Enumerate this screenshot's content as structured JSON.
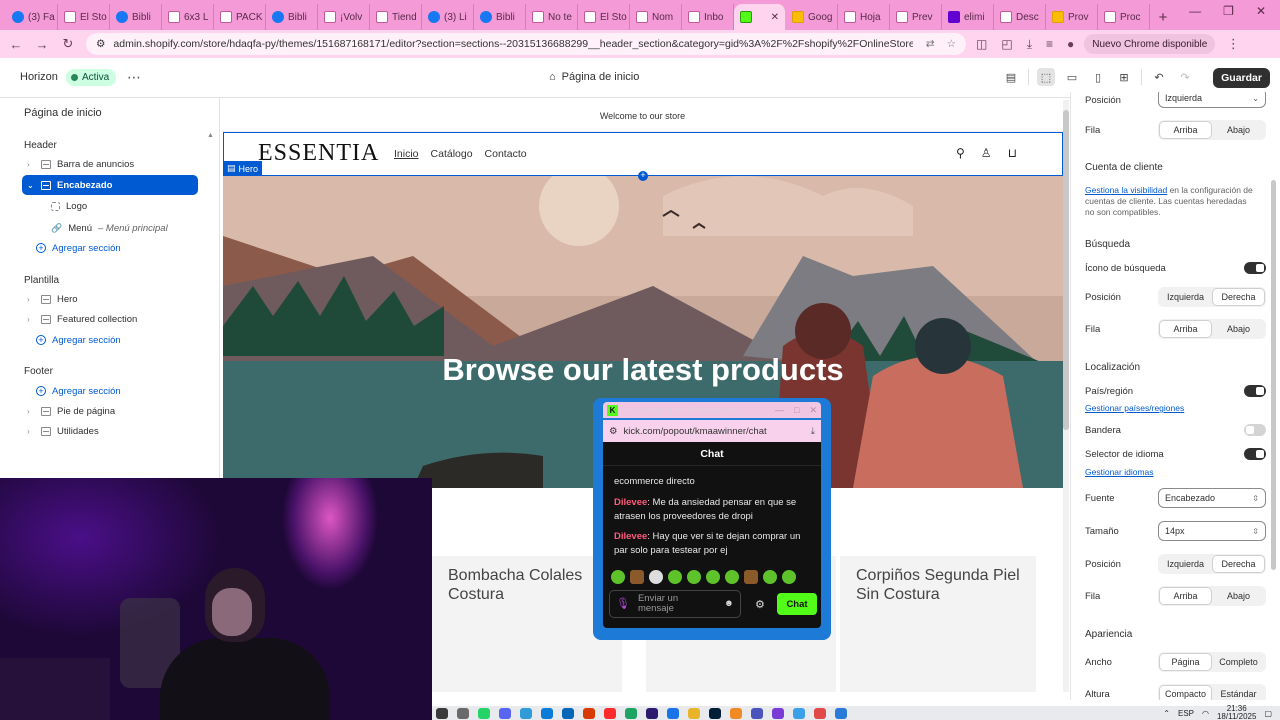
{
  "browser": {
    "tabs": [
      {
        "label": "(3) Fa",
        "icon": "facebook"
      },
      {
        "label": "El Sto",
        "icon": "doc"
      },
      {
        "label": "Bibli",
        "icon": "meta"
      },
      {
        "label": "6x3 L",
        "icon": "doc"
      },
      {
        "label": "PACK",
        "icon": "doc"
      },
      {
        "label": "Bibli",
        "icon": "meta"
      },
      {
        "label": "¡Volv",
        "icon": "doc"
      },
      {
        "label": "Tiend",
        "icon": "doc"
      },
      {
        "label": "(3) Li",
        "icon": "facebook"
      },
      {
        "label": "Bibli",
        "icon": "meta"
      },
      {
        "label": "No te",
        "icon": "doc"
      },
      {
        "label": "El Sto",
        "icon": "doc"
      },
      {
        "label": "Nom",
        "icon": "doc"
      },
      {
        "label": "Inbo",
        "icon": "gmail"
      },
      {
        "label": "",
        "icon": "shopify",
        "active": true
      },
      {
        "label": "Goog",
        "icon": "drive"
      },
      {
        "label": "Hoja",
        "icon": "doc"
      },
      {
        "label": "Prev",
        "icon": "doc"
      },
      {
        "label": "elimi",
        "icon": "yahoo"
      },
      {
        "label": "Desc",
        "icon": "doc"
      },
      {
        "label": "Prov",
        "icon": "drive"
      },
      {
        "label": "Proc",
        "icon": "doc"
      }
    ],
    "url": "admin.shopify.com/store/hdaqfa-py/themes/151687168171/editor?section=sections--20315136688299__header_section&category=gid%3A%2F%2Fshopify%2FOnlineStoreThemeSettingsCategory%2FLogo%5...",
    "profile_label": "Nuevo Chrome disponible"
  },
  "editor": {
    "theme_name": "Horizon",
    "status_badge": "Activa",
    "page_selector": "Página de inicio",
    "save_label": "Guardar"
  },
  "sidebar": {
    "title": "Página de inicio",
    "groups": {
      "header": "Header",
      "template": "Plantilla",
      "footer": "Footer"
    },
    "header_items": {
      "announcement": "Barra de anuncios",
      "header": "Encabezado",
      "logo": "Logo",
      "menu_label": "Menú",
      "menu_sub": " – Menú principal",
      "add_section": "Agregar sección"
    },
    "template_items": {
      "hero": "Hero",
      "featured": "Featured collection",
      "add_section": "Agregar sección"
    },
    "footer_items": {
      "add_section": "Agregar sección",
      "footer": "Pie de página",
      "utilities": "Utilidades"
    }
  },
  "preview": {
    "announcement": "Welcome to our store",
    "logo": "ESSENTIA",
    "menu": [
      "Inicio",
      "Catálogo",
      "Contacto"
    ],
    "hero_tag": "Hero",
    "hero_title": "Browse our latest products",
    "products": [
      {
        "name": "Bombacha Colales Costura"
      },
      {
        "name": ""
      },
      {
        "name": "Corpiños Segunda Piel Sin Costura"
      }
    ]
  },
  "settings": {
    "position_top": {
      "label": "Posición",
      "value": "Izquierda"
    },
    "row1": {
      "label": "Fila",
      "options": [
        "Arriba",
        "Abajo"
      ],
      "selected": 0
    },
    "customer": {
      "title": "Cuenta de cliente",
      "note_link": "Gestiona la visibilidad",
      "note_rest": " en la configuración de cuentas de cliente. Las cuentas heredadas no son compatibles."
    },
    "search": {
      "title": "Búsqueda",
      "icon_label": "Ícono de búsqueda",
      "icon_on": true,
      "position_label": "Posición",
      "position_options": [
        "Izquierda",
        "Derecha"
      ],
      "position_selected": 1,
      "row_label": "Fila",
      "row_options": [
        "Arriba",
        "Abajo"
      ],
      "row_selected": 0
    },
    "localization": {
      "title": "Localización",
      "country_label": "País/región",
      "country_on": true,
      "country_link": "Gestionar países/regiones",
      "flag_label": "Bandera",
      "flag_on": false,
      "lang_label": "Selector de idioma",
      "lang_on": true,
      "lang_link": "Gestionar idiomas",
      "font_label": "Fuente",
      "font_value": "Encabezado",
      "size_label": "Tamaño",
      "size_value": "14px",
      "position_label": "Posición",
      "position_options": [
        "Izquierda",
        "Derecha"
      ],
      "position_selected": 1,
      "row_label": "Fila",
      "row_options": [
        "Arriba",
        "Abajo"
      ],
      "row_selected": 0
    },
    "appearance": {
      "title": "Apariencia",
      "width_label": "Ancho",
      "width_options": [
        "Página",
        "Completo"
      ],
      "width_selected": 0,
      "height_label": "Altura",
      "height_options": [
        "Compacto",
        "Estándar"
      ],
      "height_selected": 0
    }
  },
  "chat": {
    "window_title": "kick.com/popout/kmaawinner...",
    "url": "kick.com/popout/kmaawinner/chat",
    "header": "Chat",
    "messages": [
      {
        "user": "",
        "text": "ecommerce directo"
      },
      {
        "user": "Dilevee",
        "text": ": Me da ansiedad pensar en que se atrasen los proveedores de dropi"
      },
      {
        "user": "Dilevee",
        "text": ": Hay que ver si te dejan comprar un par solo para testear por ej"
      }
    ],
    "input_placeholder": "Enviar un mensaje",
    "send_label": "Chat"
  },
  "taskbar": {
    "lang": "ESP",
    "time": "21:36",
    "date": "18/11/2025"
  },
  "colors": {
    "accent": "#005bd3",
    "chrome_tabs": "#f49ad6",
    "chrome_bar": "#ffd4ef",
    "kick_green": "#53fc18",
    "badge_bg": "#cdfee1"
  }
}
